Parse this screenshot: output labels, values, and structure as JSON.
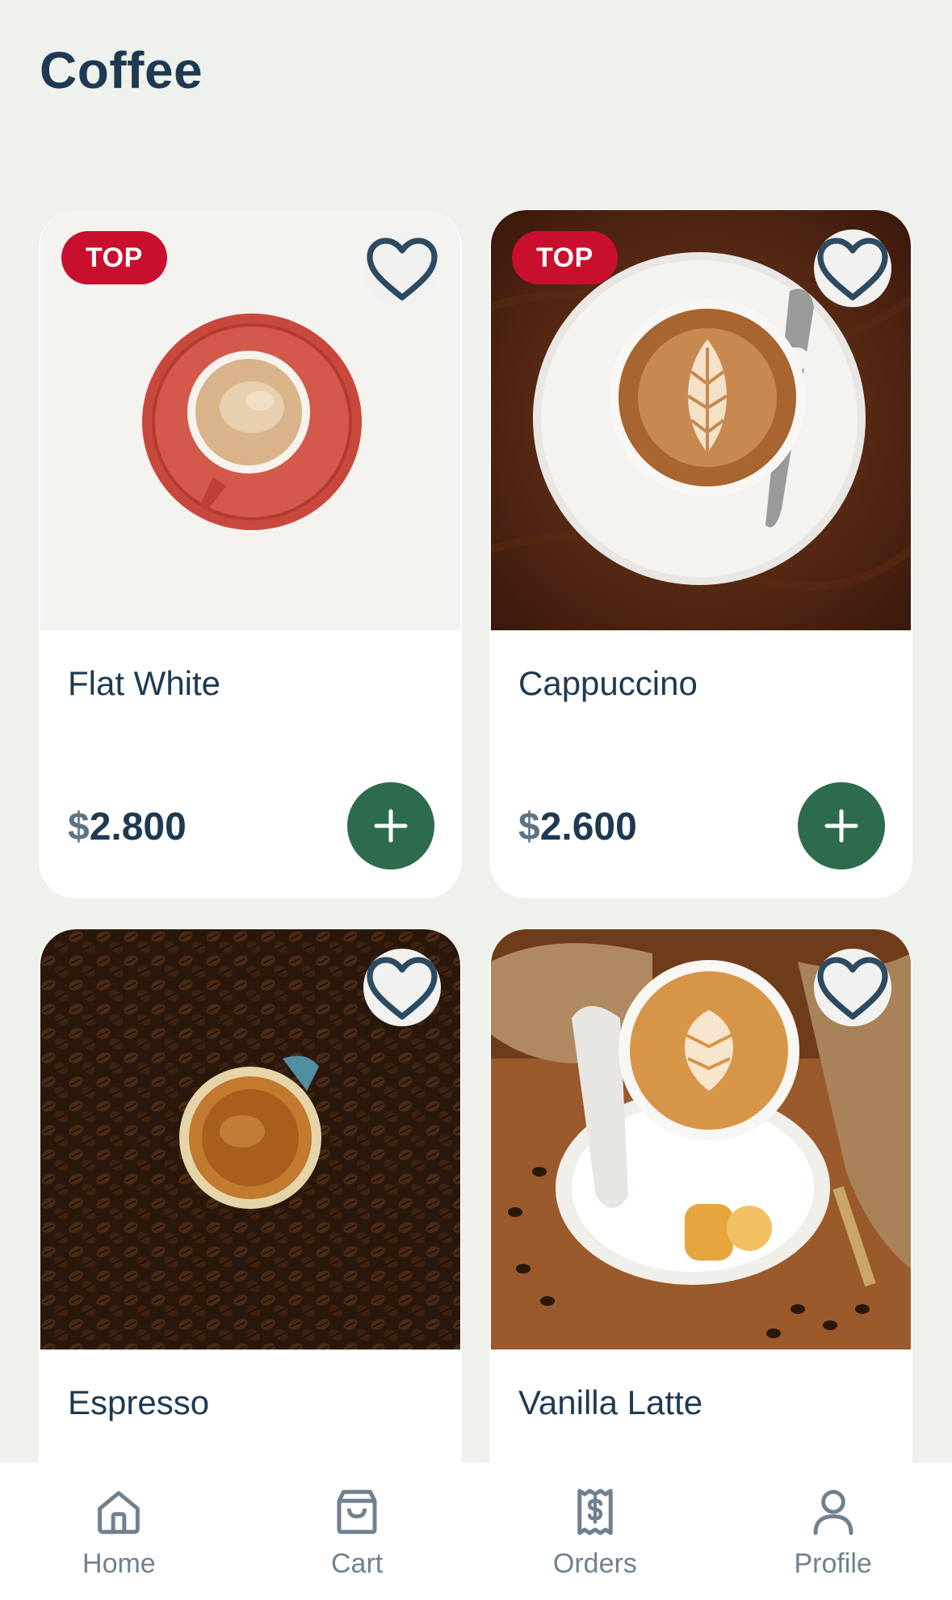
{
  "header": {
    "title": "Coffee"
  },
  "products": [
    {
      "name": "Flat White",
      "currency": "$",
      "price": "2.800",
      "badge": "TOP"
    },
    {
      "name": "Cappuccino",
      "currency": "$",
      "price": "2.600",
      "badge": "TOP"
    },
    {
      "name": "Espresso",
      "badge": ""
    },
    {
      "name": "Vanilla Latte",
      "badge": ""
    }
  ],
  "tabbar": {
    "items": [
      {
        "label": "Home",
        "icon": "home-icon"
      },
      {
        "label": "Cart",
        "icon": "shopping-bag-icon"
      },
      {
        "label": "Orders",
        "icon": "receipt-icon"
      },
      {
        "label": "Profile",
        "icon": "user-icon"
      }
    ]
  },
  "colors": {
    "background": "#eff1ed",
    "text": "#1d3a52",
    "accent_green": "#2d6b4d",
    "badge_red": "#c8102e",
    "tab_inactive": "#6f8191"
  }
}
